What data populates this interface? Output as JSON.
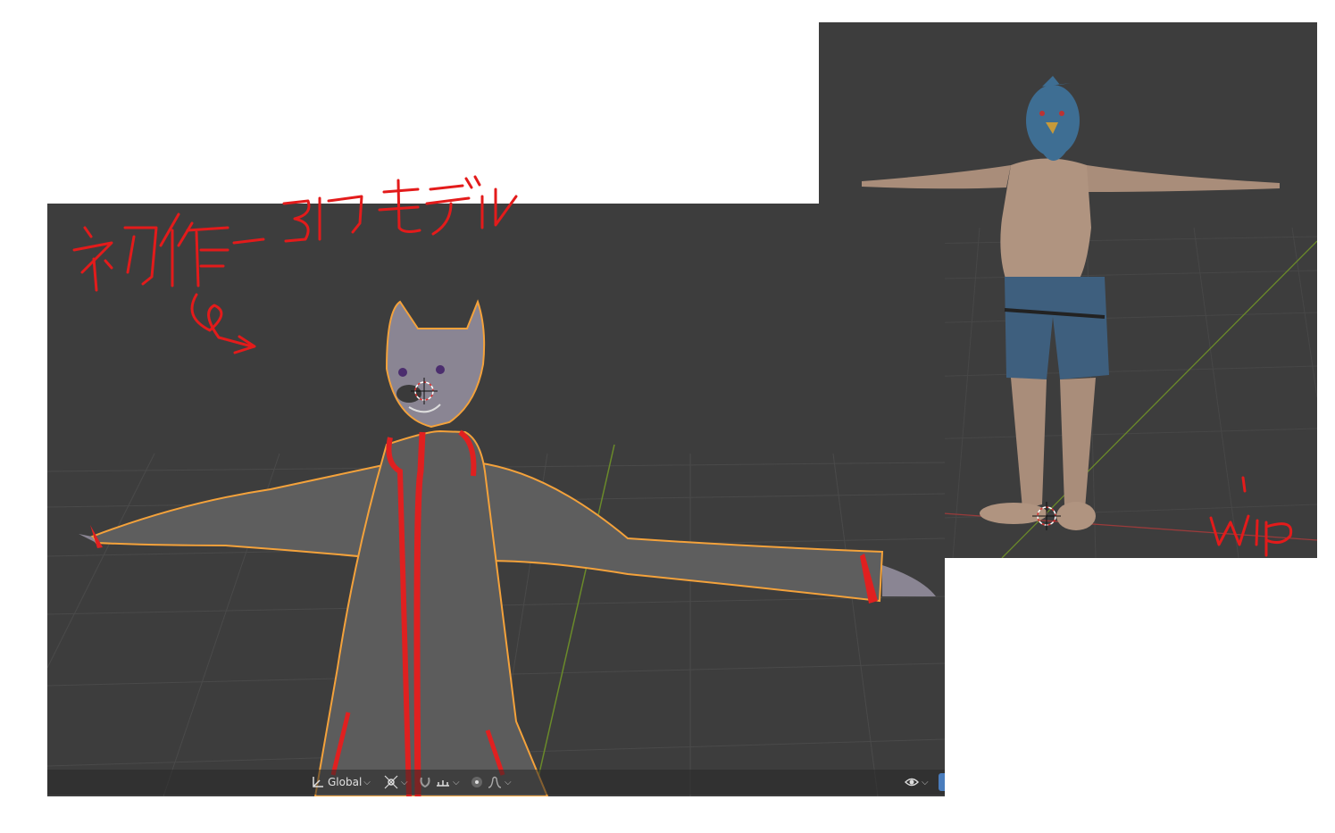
{
  "left_viewport": {
    "header": {
      "orientation_label": "Global",
      "orientation_icon": "transform-orientation-icon",
      "pivot_icon": "pivot-point-icon",
      "snap_icon": "snap-magnet-icon",
      "snap_target_icon": "snap-increment-icon",
      "proportional_icon": "proportional-edit-icon",
      "falloff_icon": "falloff-curve-icon",
      "visibility_icon": "eye-visibility-icon",
      "gizmo_icon": "gizmo-icon"
    },
    "model_description_icon": "wolf-character-in-jacket"
  },
  "right_viewport": {
    "model_description_icon": "bird-character-in-shorts"
  },
  "annotation_colors": {
    "ink": "#e31b1b",
    "selection_outline": "#f4a23b"
  }
}
